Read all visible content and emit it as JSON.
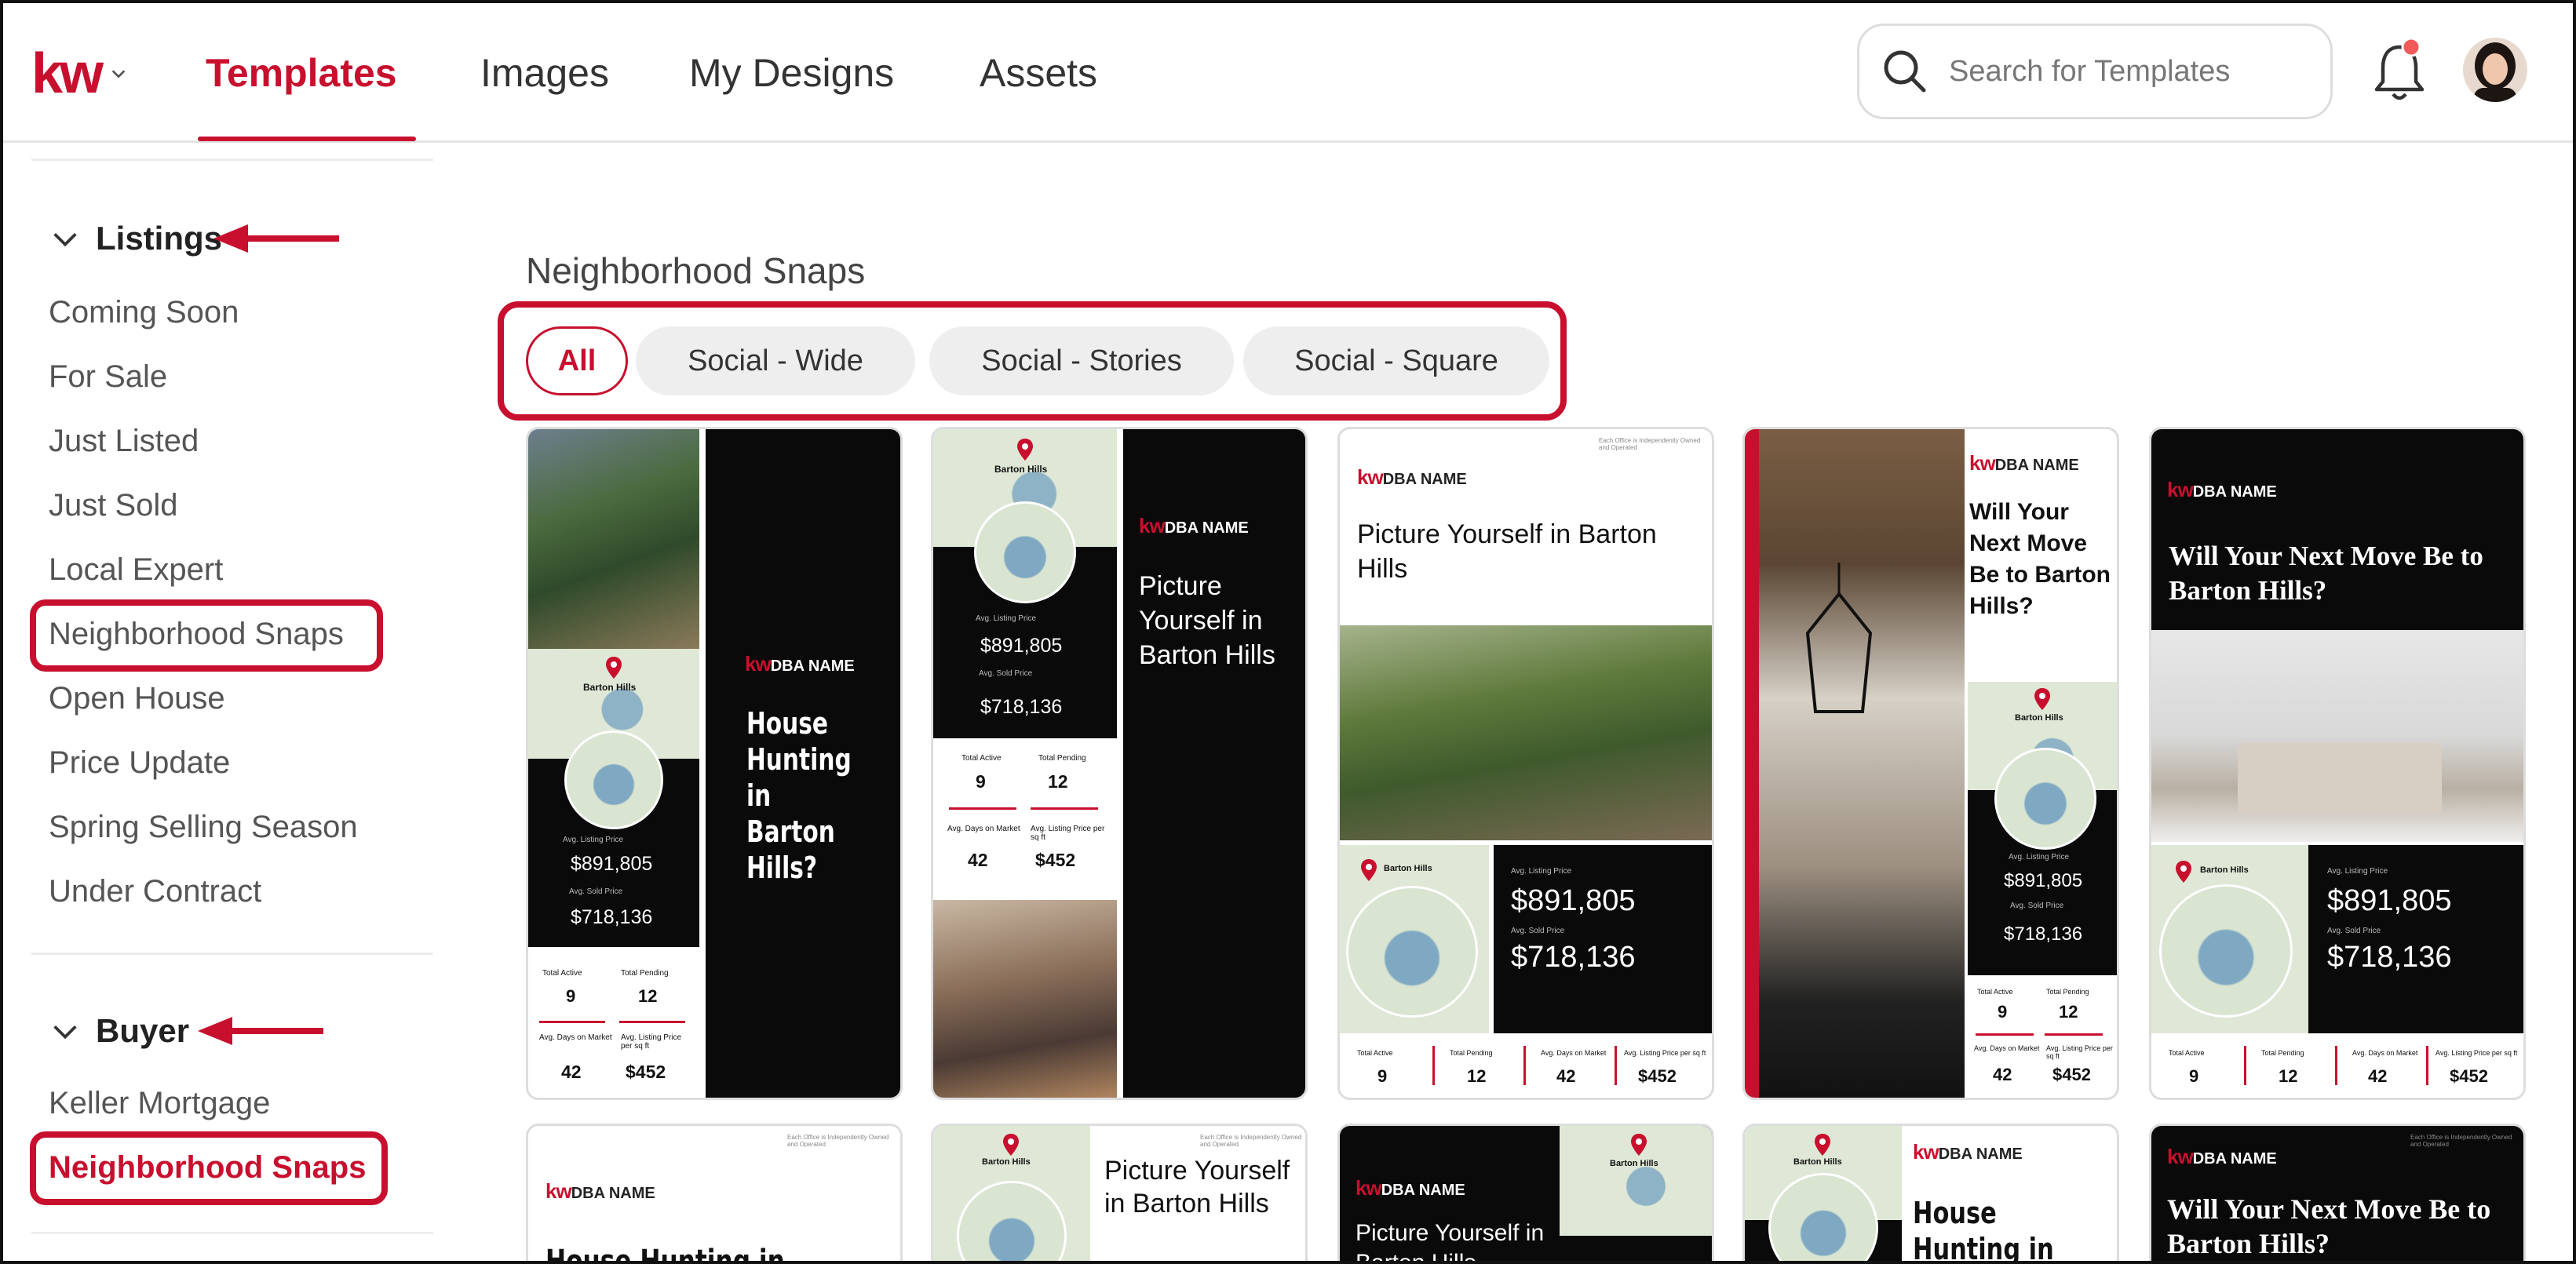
{
  "header": {
    "logo_text": "kw",
    "nav": [
      {
        "label": "Templates",
        "active": true
      },
      {
        "label": "Images"
      },
      {
        "label": "My Designs"
      },
      {
        "label": "Assets"
      }
    ],
    "search_placeholder": "Search for Templates",
    "accent_color": "#c8102e"
  },
  "sidebar": {
    "listings": {
      "label": "Listings",
      "items": [
        "Coming Soon",
        "For Sale",
        "Just Listed",
        "Just Sold",
        "Local Expert",
        "Neighborhood Snaps",
        "Open House",
        "Price Update",
        "Spring Selling Season",
        "Under Contract"
      ]
    },
    "buyer": {
      "label": "Buyer",
      "items": [
        "Keller Mortgage",
        "Neighborhood Snaps"
      ],
      "active_item": "Neighborhood Snaps"
    }
  },
  "main": {
    "title": "Neighborhood Snaps",
    "filters": [
      "All",
      "Social - Wide",
      "Social - Stories",
      "Social - Square"
    ],
    "active_filter": "All"
  },
  "cards": {
    "dba": "DBA NAME",
    "kellerwilliams": "KELLERWILLIAMS.",
    "barton_hills": "Barton Hills",
    "avg_listing_price_label": "Avg. Listing Price",
    "avg_sold_price_label": "Avg. Sold Price",
    "listing_price": "$891,805",
    "sold_price": "$718,136",
    "total_active_label": "Total Active",
    "total_pending_label": "Total Pending",
    "total_active": "9",
    "total_pending": "12",
    "avg_days_label": "Avg. Days on Market",
    "price_per_sqft_label": "Avg. Listing Price per sq ft",
    "avg_days": "42",
    "price_per_sqft": "$452",
    "headline_house_hunting": "House Hunting in Barton Hills?",
    "headline_picture": "Picture Yourself in Barton Hills",
    "headline_next_move_a": "Will Your Next Move Be to Barton Hills?",
    "headline_next_move_b": "Will Your Next Move Be to Barton Hills?",
    "row2_house_hunting": "House Hunting in",
    "row2_picture_a": "Picture Yourself in Barton Hills",
    "row2_picture_b": "Picture Yourself in Barton Hills",
    "row2_house_hunting_b": "House Hunting in",
    "row2_next_move": "Will Your Next Move Be to Barton Hills?",
    "disclaimer": "Each Office is Independently Owned and Operated"
  }
}
